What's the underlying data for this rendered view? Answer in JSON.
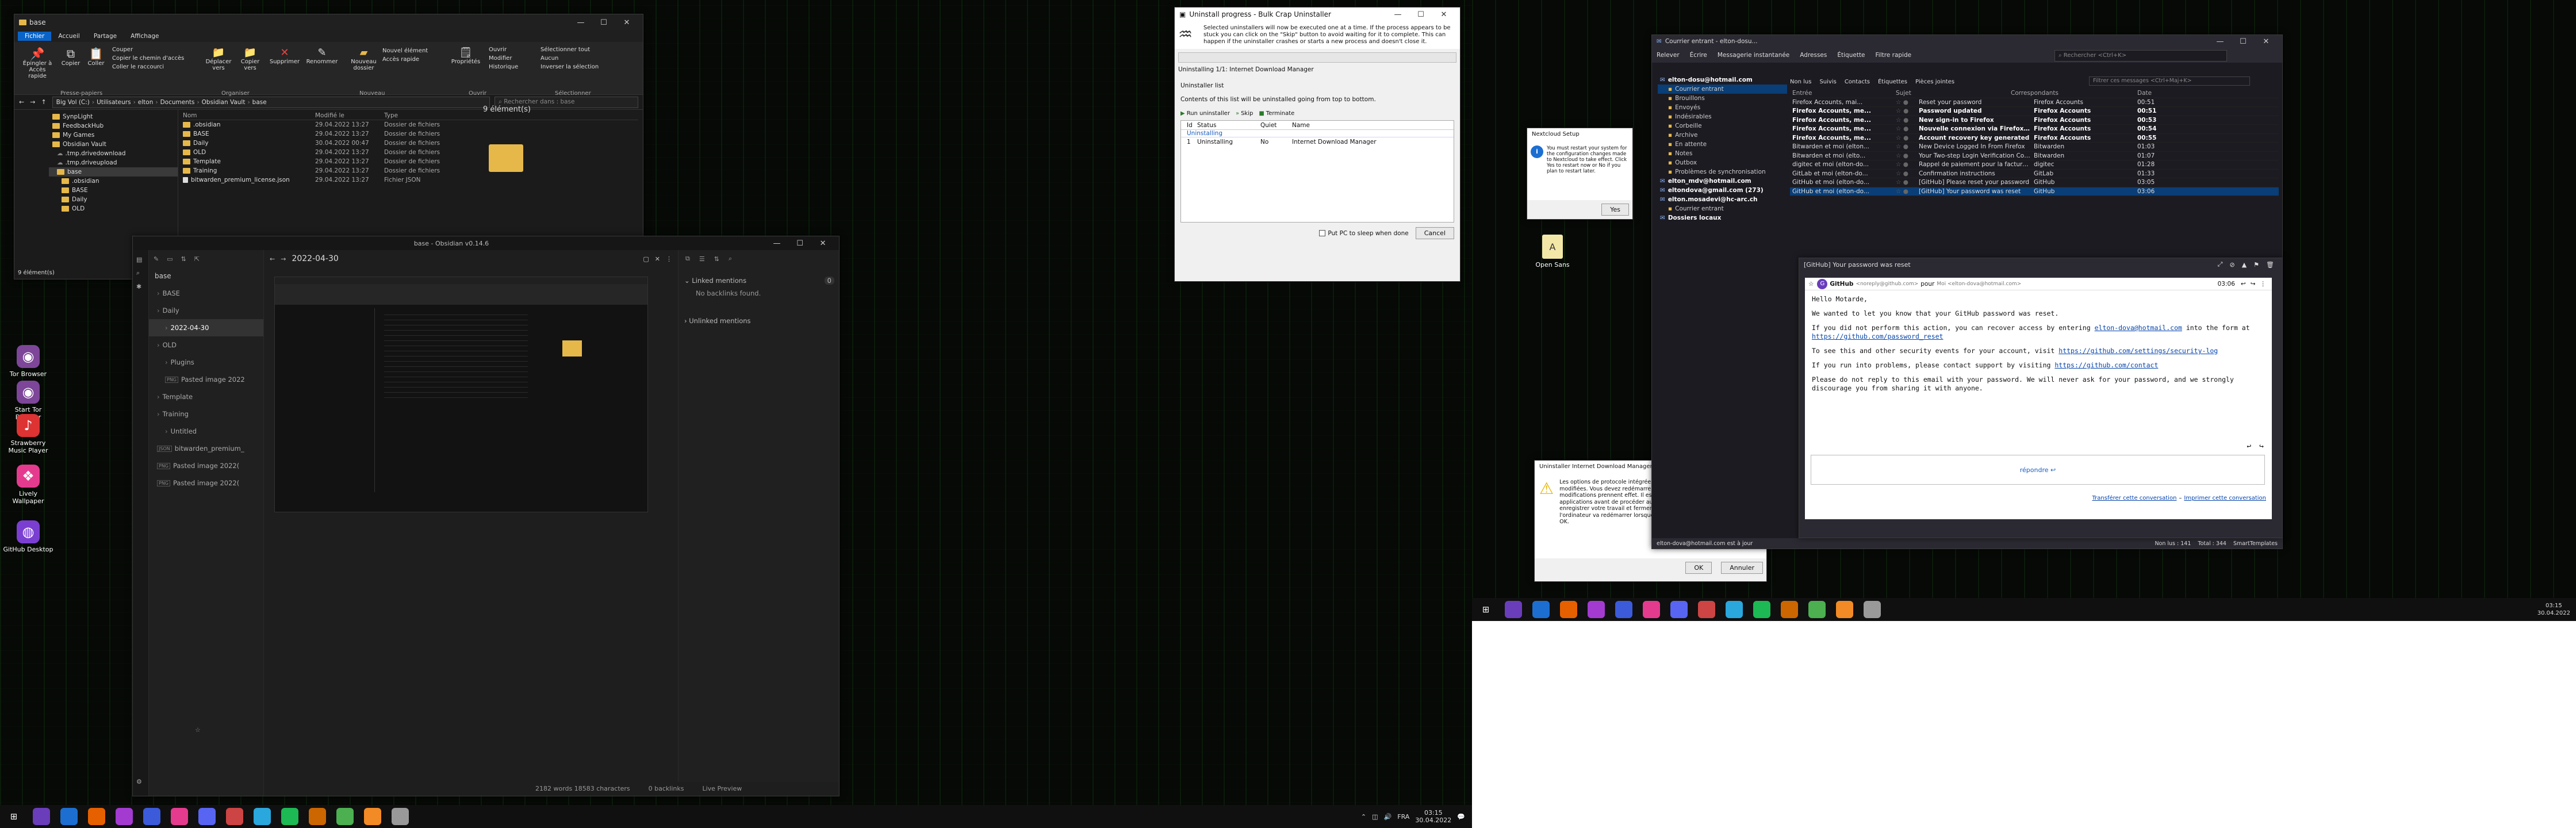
{
  "explorer": {
    "title": "base",
    "menu_tabs": [
      "Fichier",
      "Accueil",
      "Partage",
      "Affichage"
    ],
    "ribbon_groups": [
      "Presse-papiers",
      "Organiser",
      "Nouveau",
      "Ouvrir",
      "Sélectionner"
    ],
    "ribbon_buttons": {
      "pin": "Épingler à Accès rapide",
      "copy": "Copier",
      "paste": "Coller",
      "cut": "Couper",
      "copy_path": "Copier le chemin d'accès",
      "paste_shortcut": "Coller le raccourci",
      "move": "Déplacer vers",
      "copy_to": "Copier vers",
      "delete": "Supprimer",
      "rename": "Renommer",
      "new_folder": "Nouveau dossier",
      "new_item": "Nouvel élément",
      "easy_access": "Accès rapide",
      "properties": "Propriétés",
      "open": "Ouvrir",
      "modify": "Modifier",
      "history": "Historique",
      "select_all": "Sélectionner tout",
      "select_none": "Aucun",
      "invert": "Inverser la sélection"
    },
    "breadcrumb": [
      "Big Vol (C:)",
      "Utilisateurs",
      "elton",
      "Documents",
      "Obsidian Vault",
      "base"
    ],
    "search_placeholder": "Rechercher dans : base",
    "item_count": "9 élément(s)",
    "status_bar": "9 élément(s)",
    "columns": [
      "Nom",
      "Modifié le",
      "Type"
    ],
    "nav_tree": [
      "SynpLight",
      "FeedbackHub",
      "My Games",
      "Obsidian Vault",
      "base",
      ".obsidian",
      "BASE",
      "Daily",
      "OLD"
    ],
    "nav_extra": [
      ".tmp.drivedownload",
      ".tmp.driveupload"
    ],
    "files": [
      {
        "name": ".obsidian",
        "date": "29.04.2022 13:27",
        "type": "Dossier de fichiers"
      },
      {
        "name": "BASE",
        "date": "29.04.2022 13:27",
        "type": "Dossier de fichiers"
      },
      {
        "name": "Daily",
        "date": "30.04.2022 00:47",
        "type": "Dossier de fichiers"
      },
      {
        "name": "OLD",
        "date": "29.04.2022 13:27",
        "type": "Dossier de fichiers"
      },
      {
        "name": "Template",
        "date": "29.04.2022 13:27",
        "type": "Dossier de fichiers"
      },
      {
        "name": "Training",
        "date": "29.04.2022 13:27",
        "type": "Dossier de fichiers"
      },
      {
        "name": "bitwarden_premium_license.json",
        "date": "29.04.2022 13:27",
        "type": "Fichier JSON"
      }
    ]
  },
  "obsidian": {
    "title": "base - Obsidian v0.14.6",
    "note_title": "2022-04-30",
    "vault_name": "base",
    "tree": [
      "BASE",
      "Daily",
      "2022-04-30",
      "OLD",
      "Plugins",
      "Pasted image 2022",
      "Template",
      "Training",
      "Untitled",
      "bitwarden_premium_",
      "Pasted image 2022(",
      "Pasted image 2022("
    ],
    "tree_badges": [
      "",
      "",
      "",
      "",
      "",
      "PNG",
      "",
      "",
      "",
      "JSON",
      "PNG",
      "PNG"
    ],
    "linked_mentions": "Linked mentions",
    "no_backlinks": "No backlinks found.",
    "unlinked_mentions": "Unlinked mentions",
    "status_words": "2182 words 18583 characters",
    "status_backlinks": "0 backlinks",
    "status_mode": "Live Preview",
    "linked_count": "0"
  },
  "uninstaller": {
    "title": "Uninstall progress - Bulk Crap Uninstaller",
    "intro": "Selected uninstallers will now be executed one at a time. If the process appears to be stuck you can click on the \"Skip\" button to avoid waiting for it to complete. This can happen if the uninstaller crashes or starts a new process and doesn't close it.",
    "progress_label": "Uninstalling 1/1: Internet Download Manager",
    "list_heading": "Uninstaller list",
    "list_desc": "Contents of this list will be uninstalled going from top to bottom.",
    "toolbar": [
      "Run uninstaller",
      "Skip",
      "Terminate"
    ],
    "columns": [
      "Id",
      "Status",
      "Quiet",
      "Name"
    ],
    "group": "Uninstalling",
    "row": {
      "id": "1",
      "status": "Uninstalling",
      "quiet": "No",
      "name": "Internet Download Manager"
    },
    "sleep_label": "Put PC to sleep when done",
    "cancel": "Cancel"
  },
  "nextcloud_dialog": {
    "title": "Nextcloud Setup",
    "text": "You must restart your system for the configuration changes made to Nextcloud to take effect. Click Yes to restart now or No if you plan to restart later.",
    "yes": "Yes"
  },
  "idm_dialog": {
    "title": "Uninstaller Internet Download Manager",
    "text": "Les options de protocole intégrées dans le navigateur ont été modifiées. Vous devez redémarrer votre ordinateur pour que les modifications prennent effet. Il est recommandé de fermer toutes les applications avant de procéder au redémarrage. S'il vous plaît enregistrer votre travail et fermer toutes les applications maintenant, l'ordinateur va redémarrer lorsque vous aurez appuyé sur le bouton OK.",
    "ok": "OK",
    "cancel": "Annuler"
  },
  "desktop_icons_left": [
    {
      "label": "Tor Browser",
      "color": "#7d4698",
      "glyph": "◉"
    },
    {
      "label": "Start Tor Browser",
      "color": "#7d4698",
      "glyph": "◉"
    },
    {
      "label": "Strawberry Music Player",
      "color": "#d33",
      "glyph": "♪"
    },
    {
      "label": "Lively Wallpaper",
      "color": "#e53b8e",
      "glyph": "❖"
    },
    {
      "label": "GitHub Desktop",
      "color": "#7a3fd1",
      "glyph": "◍"
    }
  ],
  "desktop_icon_right": {
    "label": "Open Sans"
  },
  "thunderbird": {
    "title": "Courrier entrant - elton-dosu...",
    "toolbar": [
      "Relever",
      "Écrire",
      "Messagerie instantanée",
      "Adresses",
      "Étiquette",
      "Filtre rapide"
    ],
    "search_placeholder": "Rechercher <Ctrl+K>",
    "filter_bar": [
      "Non lus",
      "Suivis",
      "Contacts",
      "Étiquettes",
      "Pièces jointes"
    ],
    "filter_placeholder": "Filtrer ces messages <Ctrl+Maj+K>",
    "folders": [
      {
        "name": "elton-dosu@hotmail.com",
        "bold": true
      },
      {
        "name": "Courrier entrant",
        "bold": false,
        "selected": true
      },
      {
        "name": "Brouillons",
        "bold": false
      },
      {
        "name": "Envoyés",
        "bold": false
      },
      {
        "name": "Indésirables",
        "bold": false
      },
      {
        "name": "Corbeille",
        "bold": false
      },
      {
        "name": "Archive",
        "bold": false
      },
      {
        "name": "En attente",
        "bold": false
      },
      {
        "name": "Notes",
        "bold": false
      },
      {
        "name": "Outbox",
        "bold": false
      },
      {
        "name": "Problèmes de synchronisation",
        "bold": false
      },
      {
        "name": "elton_mdv@hotmail.com",
        "bold": true
      },
      {
        "name": "eltondova@gmail.com (273)",
        "bold": true
      },
      {
        "name": "elton.mosadevi@hc-arc.ch",
        "bold": true
      },
      {
        "name": "Courrier entrant",
        "bold": false
      },
      {
        "name": "Dossiers locaux",
        "bold": true
      }
    ],
    "columns": [
      "Entrée",
      "Sujet",
      "Correspondants",
      "Date"
    ],
    "messages": [
      {
        "from": "Firefox Accounts, mai...",
        "subject": "Reset your password",
        "corr": "Firefox Accounts",
        "date": "00:51",
        "unread": false
      },
      {
        "from": "Firefox Accounts, me...",
        "subject": "Password updated",
        "corr": "Firefox Accounts",
        "date": "00:51",
        "unread": true
      },
      {
        "from": "Firefox Accounts, me...",
        "subject": "New sign-in to Firefox",
        "corr": "Firefox Accounts",
        "date": "00:53",
        "unread": true
      },
      {
        "from": "Firefox Accounts, me...",
        "subject": "Nouvelle connexion via Firefox fo...",
        "corr": "Firefox Accounts",
        "date": "00:54",
        "unread": true
      },
      {
        "from": "Firefox Accounts, me...",
        "subject": "Account recovery key generated",
        "corr": "Firefox Accounts",
        "date": "00:55",
        "unread": true
      },
      {
        "from": "Bitwarden et moi (elton...",
        "subject": "New Device Logged In From Firefox",
        "corr": "Bitwarden",
        "date": "01:03",
        "unread": false
      },
      {
        "from": "Bitwarden et moi (elto...",
        "subject": "Your Two-step Login Verification Code",
        "corr": "Bitwarden",
        "date": "01:07",
        "unread": false
      },
      {
        "from": "digitec et moi (elton-do...",
        "subject": "Rappel de paiement pour la facture ...",
        "corr": "digitec",
        "date": "01:28",
        "unread": false
      },
      {
        "from": "GitLab et moi (elton-do...",
        "subject": "Confirmation instructions",
        "corr": "GitLab",
        "date": "01:33",
        "unread": false
      },
      {
        "from": "GitHub et moi (elton-do...",
        "subject": "[GitHub] Please reset your password",
        "corr": "GitHub",
        "date": "03:05",
        "unread": false
      },
      {
        "from": "GitHub et moi (elton-do...",
        "subject": "[GitHub] Your password was reset",
        "corr": "GitHub",
        "date": "03:06",
        "unread": false,
        "selected": true
      }
    ],
    "status_left": "elton-dova@hotmail.com est à jour",
    "status_unread": "Non lus : 141",
    "status_total": "Total : 344",
    "status_templates": "SmartTemplates"
  },
  "message_window": {
    "title": "[GitHub] Your password was reset",
    "sender": "GitHub",
    "sender_email": "<noreply@github.com>",
    "to_prefix": "pour",
    "to_email": "Moi <elton-dova@hotmail.com>",
    "time": "03:06",
    "greeting": "Hello Motarde,",
    "p1": "We wanted to let you know that your GitHub password was reset.",
    "p2a": "If you did not perform this action, you can recover access by entering",
    "p2_link1": "elton-dova@hotmail.com",
    "p2b": "into the form at",
    "p2_link2": "https://github.com/password_reset",
    "p3a": "To see this and other security events for your account, visit",
    "p3_link": "https://github.com/settings/security-log",
    "p4a": "If you run into problems, please contact support by visiting",
    "p4_link": "https://github.com/contact",
    "p5": "Please do not reply to this email with your password. We will never ask for your password, and we strongly discourage you from sharing it with anyone.",
    "reply": "répondre",
    "footer_link1": "Transférer cette conversation",
    "footer_link2": "Imprimer cette conversation"
  },
  "clock": {
    "time": "03:15",
    "date": "30.04.2022",
    "lang": "FRA"
  },
  "colors": {
    "accent": "#0a64c8",
    "folder": "#e6b84a",
    "link": "#0645ad"
  }
}
